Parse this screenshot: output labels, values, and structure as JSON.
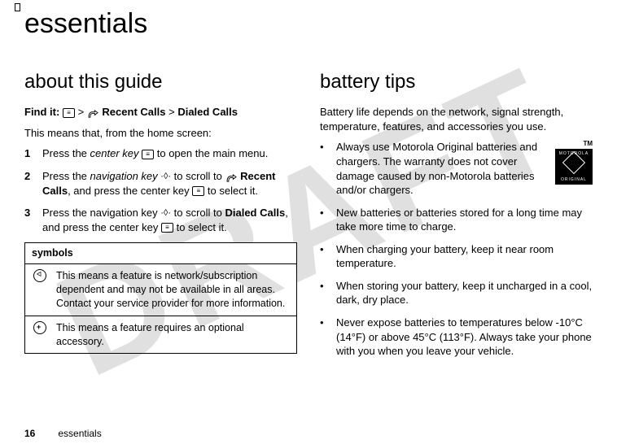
{
  "watermark": "DRAFT",
  "page_title": "essentials",
  "left": {
    "section_title": "about this guide",
    "find_it_label": "Find it:",
    "find_it_sep1": ">",
    "find_it_part1": "Recent Calls",
    "find_it_sep2": ">",
    "find_it_part2": "Dialed Calls",
    "intro": "This means that, from the home screen:",
    "steps": [
      {
        "n": "1",
        "pre": "Press the ",
        "em": "center key",
        "post": " to open the main menu."
      },
      {
        "n": "2",
        "pre": "Press the ",
        "em": "navigation key",
        "mid": " to scroll to ",
        "bold1": "Recent Calls",
        "post2": ", and press the center key ",
        "post3": " to select it."
      },
      {
        "n": "3",
        "pre": "Press the navigation key ",
        "mid": " to scroll to ",
        "bold1": "Dialed Calls",
        "post2": ", and press the center key ",
        "post3": " to select it."
      }
    ],
    "symbols_header": "symbols",
    "symbols": [
      "This means a feature is network/subscription dependent and may not be available in all areas. Contact your service provider for more information.",
      "This means a feature requires an optional accessory."
    ]
  },
  "right": {
    "section_title": "battery tips",
    "intro": "Battery life depends on the network, signal strength, temperature, features, and accessories you use.",
    "moto_tm": "TM",
    "moto_top": "MOTOROLA",
    "moto_bottom": "ORIGINAL",
    "bullets": [
      "Always use Motorola Original batteries and chargers. The warranty does not cover damage caused by non-Motorola batteries and/or chargers.",
      "New batteries or batteries stored for a long time may take more time to charge.",
      "When charging your battery, keep it near room temperature.",
      "When storing your battery, keep it uncharged in a cool, dark, dry place.",
      "Never expose batteries to temperatures below -10°C (14°F) or above 45°C (113°F). Always take your phone with you when you leave your vehicle."
    ]
  },
  "footer": {
    "page_number": "16",
    "section": "essentials"
  }
}
